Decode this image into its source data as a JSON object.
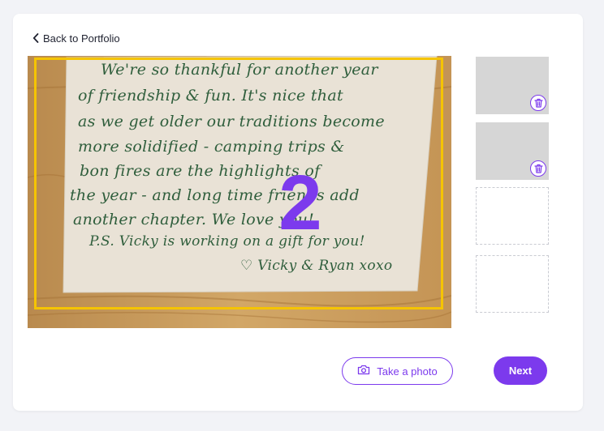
{
  "nav": {
    "back_label": "Back to Portfolio",
    "back_icon": "chevron-left-icon"
  },
  "preview": {
    "step_number": "2",
    "crop_color": "#f5c400",
    "note_lines": [
      "We're so thankful for another year",
      "of friendship & fun. It's nice that",
      "as we get older our traditions become",
      "more solidified - camping trips &",
      "bon fires are the highlights of",
      "the year - and long time friends add",
      "another chapter. We love you!",
      "P.S. Vicky is working on a gift for you!",
      "♡ Vicky & Ryan xoxo"
    ]
  },
  "thumbnails": [
    {
      "state": "filled",
      "delete_icon": "trash-icon"
    },
    {
      "state": "filled",
      "delete_icon": "trash-icon"
    },
    {
      "state": "empty"
    },
    {
      "state": "empty"
    }
  ],
  "actions": {
    "take_photo_label": "Take a photo",
    "take_photo_icon": "camera-icon",
    "next_label": "Next"
  },
  "colors": {
    "accent": "#7c3aed",
    "background": "#f2f3f7",
    "card": "#ffffff"
  }
}
